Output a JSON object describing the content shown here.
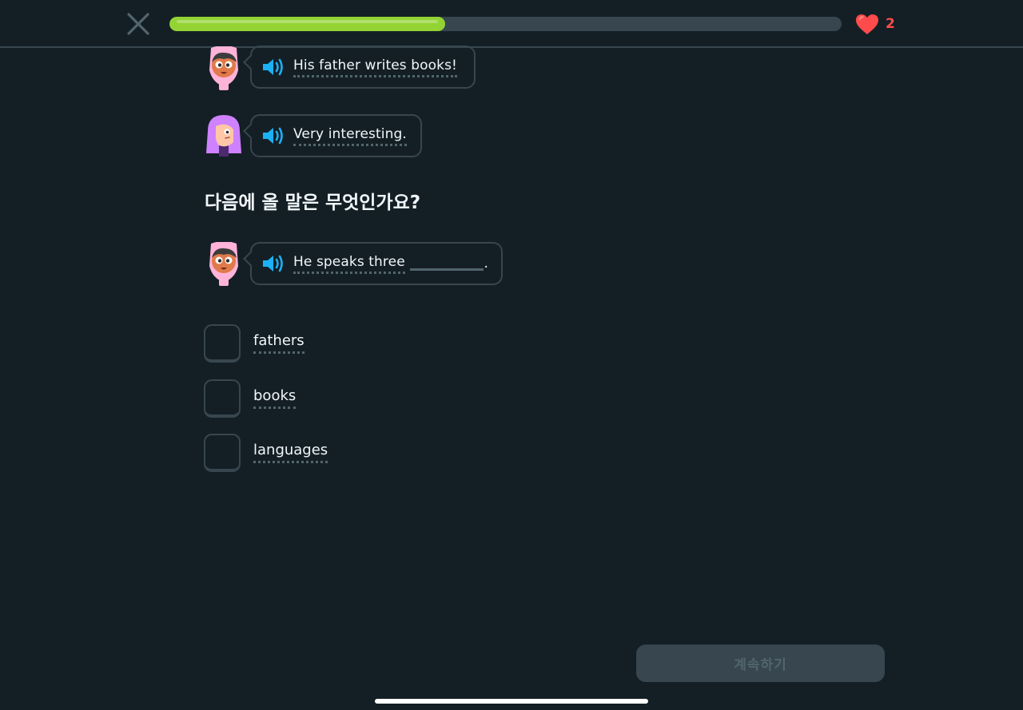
{
  "header": {
    "progress_percent": 41,
    "hearts": "2",
    "close_icon": "close-icon",
    "heart_icon": "heart-icon"
  },
  "dialogue": [
    {
      "speaker": "boy",
      "text": "His father writes books!"
    },
    {
      "speaker": "girl",
      "text": "Very interesting."
    }
  ],
  "question": {
    "prompt": "다음에 올 말은 무엇인가요?",
    "sentence_before_blank": "He speaks three",
    "sentence_after_blank": "."
  },
  "options": [
    {
      "label": "fathers",
      "selected": false
    },
    {
      "label": "books",
      "selected": false
    },
    {
      "label": "languages",
      "selected": false
    }
  ],
  "footer": {
    "continue_label": "계속하기"
  },
  "colors": {
    "background": "#141f25",
    "border": "#37464f",
    "progress": "#93d333",
    "heart": "#ff4b4b",
    "speaker": "#1cb0f6"
  }
}
